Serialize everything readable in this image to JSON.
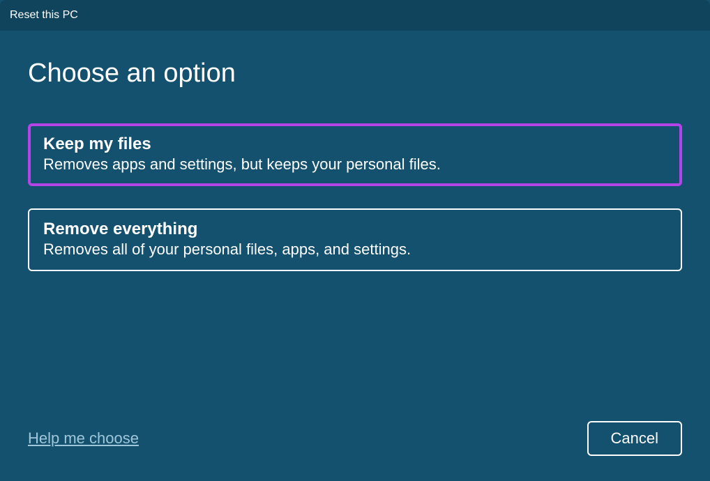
{
  "window": {
    "title": "Reset this PC"
  },
  "heading": "Choose an option",
  "options": [
    {
      "title": "Keep my files",
      "description": "Removes apps and settings, but keeps your personal files.",
      "highlighted": true
    },
    {
      "title": "Remove everything",
      "description": "Removes all of your personal files, apps, and settings.",
      "highlighted": false
    }
  ],
  "footer": {
    "help_link": "Help me choose",
    "cancel_label": "Cancel"
  }
}
